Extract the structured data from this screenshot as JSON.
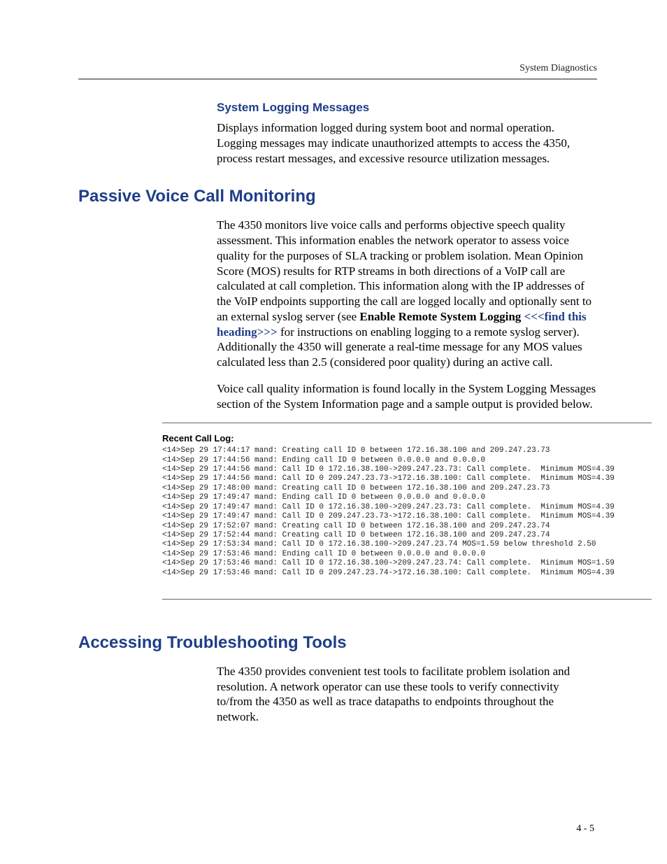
{
  "runningHead": "System Diagnostics",
  "section1": {
    "heading": "System Logging Messages",
    "body": "Displays information logged during system boot and normal operation. Logging messages may indicate unauthorized attempts to access the 4350, process restart messages, and excessive resource utilization messages."
  },
  "section2": {
    "heading": "Passive Voice Call Monitoring",
    "p1a": "The 4350 monitors live voice calls and performs objective speech quality assessment. This information enables the network operator to assess voice quality for the purposes of SLA tracking or problem isolation. Mean Opinion Score (MOS) results for RTP streams in both directions of a VoIP call are calculated at call completion. This information along with the IP addresses of the VoIP endpoints supporting the call are logged locally and optionally sent to an external syslog server (see ",
    "p1b": "Enable Remote System Logging ",
    "p1c": "<<<find this heading>>>",
    "p1d": " for instructions on enabling logging to a remote syslog server). Additionally the 4350 will generate a real-time message for any MOS values calculated less than 2.5 (considered poor quality) during an active call.",
    "p2": "Voice call quality information is found locally in the System Logging Messages section of the System Information page and a sample output is provided below."
  },
  "log": {
    "title": "Recent Call Log:",
    "lines": [
      "<14>Sep 29 17:44:17 mand: Creating call ID 0 between 172.16.38.100 and 209.247.23.73",
      "<14>Sep 29 17:44:56 mand: Ending call ID 0 between 0.0.0.0 and 0.0.0.0",
      "<14>Sep 29 17:44:56 mand: Call ID 0 172.16.38.100->209.247.23.73: Call complete.  Minimum MOS=4.39",
      "<14>Sep 29 17:44:56 mand: Call ID 0 209.247.23.73->172.16.38.100: Call complete.  Minimum MOS=4.39",
      "<14>Sep 29 17:48:00 mand: Creating call ID 0 between 172.16.38.100 and 209.247.23.73",
      "<14>Sep 29 17:49:47 mand: Ending call ID 0 between 0.0.0.0 and 0.0.0.0",
      "<14>Sep 29 17:49:47 mand: Call ID 0 172.16.38.100->209.247.23.73: Call complete.  Minimum MOS=4.39",
      "<14>Sep 29 17:49:47 mand: Call ID 0 209.247.23.73->172.16.38.100: Call complete.  Minimum MOS=4.39",
      "<14>Sep 29 17:52:07 mand: Creating call ID 0 between 172.16.38.100 and 209.247.23.74",
      "<14>Sep 29 17:52:44 mand: Creating call ID 0 between 172.16.38.100 and 209.247.23.74",
      "<14>Sep 29 17:53:34 mand: Call ID 0 172.16.38.100->209.247.23.74 MOS=1.59 below threshold 2.50",
      "<14>Sep 29 17:53:46 mand: Ending call ID 0 between 0.0.0.0 and 0.0.0.0",
      "<14>Sep 29 17:53:46 mand: Call ID 0 172.16.38.100->209.247.23.74: Call complete.  Minimum MOS=1.59",
      "<14>Sep 29 17:53:46 mand: Call ID 0 209.247.23.74->172.16.38.100: Call complete.  Minimum MOS=4.39"
    ]
  },
  "section3": {
    "heading": "Accessing Troubleshooting Tools",
    "body": "The 4350 provides convenient test tools to facilitate problem isolation and resolution. A network operator can use these tools to verify connectivity to/from the 4350 as well as trace datapaths to endpoints throughout the network."
  },
  "pageNumber": "4 - 5"
}
